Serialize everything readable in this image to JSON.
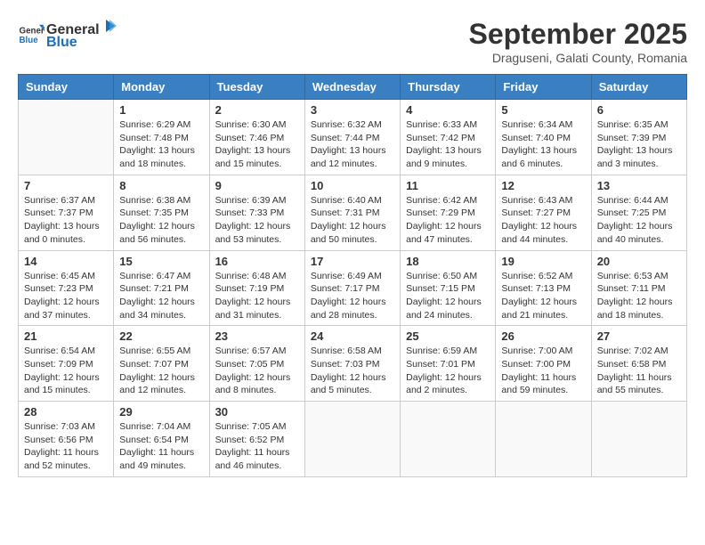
{
  "header": {
    "logo_general": "General",
    "logo_blue": "Blue",
    "month_year": "September 2025",
    "location": "Draguseni, Galati County, Romania"
  },
  "weekdays": [
    "Sunday",
    "Monday",
    "Tuesday",
    "Wednesday",
    "Thursday",
    "Friday",
    "Saturday"
  ],
  "weeks": [
    [
      {
        "day": "",
        "info": ""
      },
      {
        "day": "1",
        "info": "Sunrise: 6:29 AM\nSunset: 7:48 PM\nDaylight: 13 hours\nand 18 minutes."
      },
      {
        "day": "2",
        "info": "Sunrise: 6:30 AM\nSunset: 7:46 PM\nDaylight: 13 hours\nand 15 minutes."
      },
      {
        "day": "3",
        "info": "Sunrise: 6:32 AM\nSunset: 7:44 PM\nDaylight: 13 hours\nand 12 minutes."
      },
      {
        "day": "4",
        "info": "Sunrise: 6:33 AM\nSunset: 7:42 PM\nDaylight: 13 hours\nand 9 minutes."
      },
      {
        "day": "5",
        "info": "Sunrise: 6:34 AM\nSunset: 7:40 PM\nDaylight: 13 hours\nand 6 minutes."
      },
      {
        "day": "6",
        "info": "Sunrise: 6:35 AM\nSunset: 7:39 PM\nDaylight: 13 hours\nand 3 minutes."
      }
    ],
    [
      {
        "day": "7",
        "info": "Sunrise: 6:37 AM\nSunset: 7:37 PM\nDaylight: 13 hours\nand 0 minutes."
      },
      {
        "day": "8",
        "info": "Sunrise: 6:38 AM\nSunset: 7:35 PM\nDaylight: 12 hours\nand 56 minutes."
      },
      {
        "day": "9",
        "info": "Sunrise: 6:39 AM\nSunset: 7:33 PM\nDaylight: 12 hours\nand 53 minutes."
      },
      {
        "day": "10",
        "info": "Sunrise: 6:40 AM\nSunset: 7:31 PM\nDaylight: 12 hours\nand 50 minutes."
      },
      {
        "day": "11",
        "info": "Sunrise: 6:42 AM\nSunset: 7:29 PM\nDaylight: 12 hours\nand 47 minutes."
      },
      {
        "day": "12",
        "info": "Sunrise: 6:43 AM\nSunset: 7:27 PM\nDaylight: 12 hours\nand 44 minutes."
      },
      {
        "day": "13",
        "info": "Sunrise: 6:44 AM\nSunset: 7:25 PM\nDaylight: 12 hours\nand 40 minutes."
      }
    ],
    [
      {
        "day": "14",
        "info": "Sunrise: 6:45 AM\nSunset: 7:23 PM\nDaylight: 12 hours\nand 37 minutes."
      },
      {
        "day": "15",
        "info": "Sunrise: 6:47 AM\nSunset: 7:21 PM\nDaylight: 12 hours\nand 34 minutes."
      },
      {
        "day": "16",
        "info": "Sunrise: 6:48 AM\nSunset: 7:19 PM\nDaylight: 12 hours\nand 31 minutes."
      },
      {
        "day": "17",
        "info": "Sunrise: 6:49 AM\nSunset: 7:17 PM\nDaylight: 12 hours\nand 28 minutes."
      },
      {
        "day": "18",
        "info": "Sunrise: 6:50 AM\nSunset: 7:15 PM\nDaylight: 12 hours\nand 24 minutes."
      },
      {
        "day": "19",
        "info": "Sunrise: 6:52 AM\nSunset: 7:13 PM\nDaylight: 12 hours\nand 21 minutes."
      },
      {
        "day": "20",
        "info": "Sunrise: 6:53 AM\nSunset: 7:11 PM\nDaylight: 12 hours\nand 18 minutes."
      }
    ],
    [
      {
        "day": "21",
        "info": "Sunrise: 6:54 AM\nSunset: 7:09 PM\nDaylight: 12 hours\nand 15 minutes."
      },
      {
        "day": "22",
        "info": "Sunrise: 6:55 AM\nSunset: 7:07 PM\nDaylight: 12 hours\nand 12 minutes."
      },
      {
        "day": "23",
        "info": "Sunrise: 6:57 AM\nSunset: 7:05 PM\nDaylight: 12 hours\nand 8 minutes."
      },
      {
        "day": "24",
        "info": "Sunrise: 6:58 AM\nSunset: 7:03 PM\nDaylight: 12 hours\nand 5 minutes."
      },
      {
        "day": "25",
        "info": "Sunrise: 6:59 AM\nSunset: 7:01 PM\nDaylight: 12 hours\nand 2 minutes."
      },
      {
        "day": "26",
        "info": "Sunrise: 7:00 AM\nSunset: 7:00 PM\nDaylight: 11 hours\nand 59 minutes."
      },
      {
        "day": "27",
        "info": "Sunrise: 7:02 AM\nSunset: 6:58 PM\nDaylight: 11 hours\nand 55 minutes."
      }
    ],
    [
      {
        "day": "28",
        "info": "Sunrise: 7:03 AM\nSunset: 6:56 PM\nDaylight: 11 hours\nand 52 minutes."
      },
      {
        "day": "29",
        "info": "Sunrise: 7:04 AM\nSunset: 6:54 PM\nDaylight: 11 hours\nand 49 minutes."
      },
      {
        "day": "30",
        "info": "Sunrise: 7:05 AM\nSunset: 6:52 PM\nDaylight: 11 hours\nand 46 minutes."
      },
      {
        "day": "",
        "info": ""
      },
      {
        "day": "",
        "info": ""
      },
      {
        "day": "",
        "info": ""
      },
      {
        "day": "",
        "info": ""
      }
    ]
  ]
}
